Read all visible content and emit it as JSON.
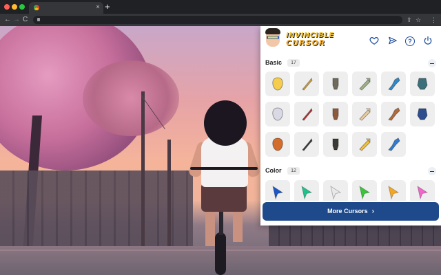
{
  "browser": {
    "tab_close": "×",
    "new_tab": "+",
    "nav_back": "←",
    "nav_forward": "→",
    "nav_reload": "C",
    "toolbar_icons": {
      "share": "⇪",
      "star": "☆",
      "menu": "⋮"
    }
  },
  "extension": {
    "logo": {
      "line1": "Invincible",
      "line2": "Cursor"
    },
    "header_icons": [
      "heart-icon",
      "send-icon",
      "help-icon",
      "power-icon"
    ],
    "help_glyph": "?",
    "sections": [
      {
        "title": "Basic",
        "count": "17",
        "items": [
          {
            "name": "invincible-face-cursor",
            "accent": "#f5cc4b"
          },
          {
            "name": "gold-scepter-cursor",
            "accent": "#d9a63b"
          },
          {
            "name": "stone-gauntlet-cursor",
            "accent": "#6f6a5a"
          },
          {
            "name": "green-axe-cursor",
            "accent": "#9fb08a"
          },
          {
            "name": "blue-boot-cursor",
            "accent": "#2f89c9"
          },
          {
            "name": "teal-helmet-cursor",
            "accent": "#3b6f7a"
          },
          {
            "name": "white-glove-cursor",
            "accent": "#d9d9e6"
          },
          {
            "name": "red-dumbbell-cursor",
            "accent": "#c0312f"
          },
          {
            "name": "brown-robot-cursor",
            "accent": "#8e5a3c"
          },
          {
            "name": "beige-wing-cursor",
            "accent": "#e8cda2"
          },
          {
            "name": "bronze-arm-cursor",
            "accent": "#b36a3a"
          },
          {
            "name": "blue-arm-cursor",
            "accent": "#2d4d8f"
          },
          {
            "name": "orange-shield-cursor",
            "accent": "#d46c2b"
          },
          {
            "name": "dark-arrow-badge-cursor",
            "accent": "#3a3a3a"
          },
          {
            "name": "black-gauntlet-cursor",
            "accent": "#3d3a36"
          },
          {
            "name": "yellow-fist-cursor",
            "accent": "#f0c23b"
          },
          {
            "name": "mini-invincible-cursor",
            "accent": "#2e7cd1"
          }
        ]
      },
      {
        "title": "Color",
        "count": "12",
        "items": [
          {
            "name": "blue-arrow-cursor",
            "accent": "#1d56c6"
          },
          {
            "name": "green-arrow-cursor",
            "accent": "#22c08c"
          },
          {
            "name": "white-arrow-cursor",
            "accent": "#e9e9ea"
          },
          {
            "name": "lime-arrow-cursor",
            "accent": "#39c43a"
          },
          {
            "name": "orange-arrow-cursor",
            "accent": "#f5a623"
          },
          {
            "name": "pink-arrow-cursor",
            "accent": "#f067c9"
          }
        ]
      }
    ],
    "more_button": {
      "label": "More Cursors",
      "chevron": "›"
    }
  }
}
